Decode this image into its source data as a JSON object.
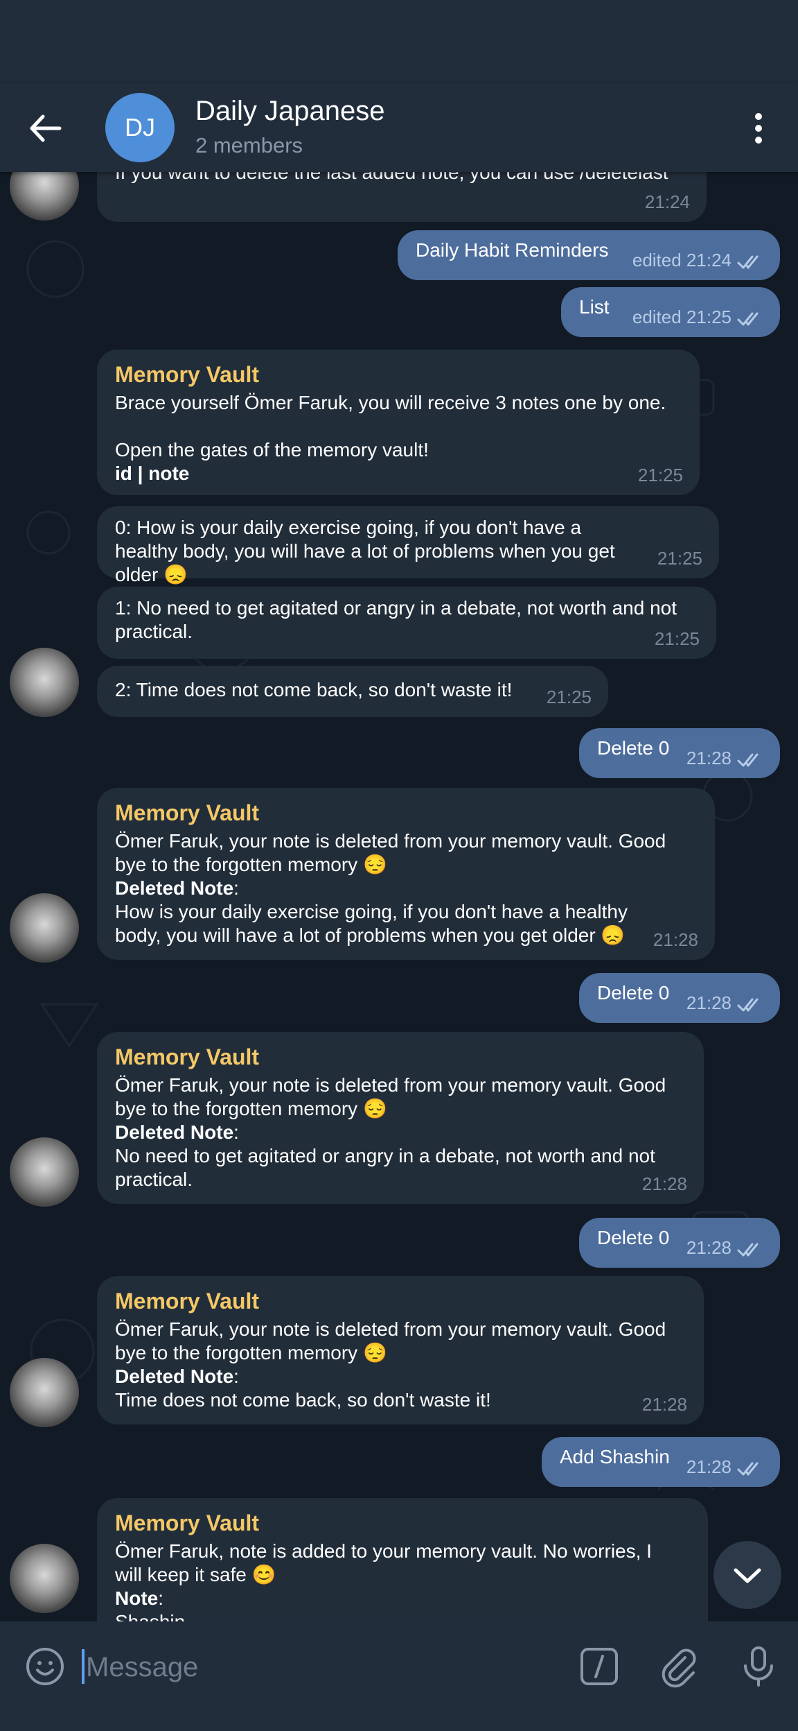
{
  "header": {
    "avatar_initials": "DJ",
    "title": "Daily Japanese",
    "subtitle": "2 members"
  },
  "messages": {
    "m0": {
      "text": "If you want to delete the last added note, you can use /deletelast",
      "time": "21:24"
    },
    "m1": {
      "text": "Daily Habit Reminders",
      "time": "edited 21:24"
    },
    "m2": {
      "text": "List",
      "time": "edited 21:25"
    },
    "m3": {
      "sender": "Memory Vault",
      "line1": "Brace yourself Ömer Faruk, you will receive 3 notes one by one.",
      "line2": "Open the gates of the memory vault!",
      "line3": "id | note",
      "time": "21:25"
    },
    "m4": {
      "text": "0: How is your daily exercise going, if you don't have a healthy body, you will have a lot of problems when you get older 😞",
      "time": "21:25"
    },
    "m5": {
      "text": "1: No need to get agitated or angry in a debate, not worth and not practical.",
      "time": "21:25"
    },
    "m6": {
      "text": "2: Time does not come back, so don't waste it!",
      "time": "21:25"
    },
    "m7": {
      "text": "Delete 0",
      "time": "21:28"
    },
    "m8": {
      "sender": "Memory Vault",
      "intro": "Ömer Faruk, your note is deleted from your memory vault. Good bye to the forgotten memory 😔",
      "label": "Deleted Note",
      "colon": ":",
      "note": "How is your daily exercise going, if you don't have a healthy body, you will have a lot of problems when you get older 😞",
      "time": "21:28"
    },
    "m9": {
      "text": "Delete 0",
      "time": "21:28"
    },
    "m10": {
      "sender": "Memory Vault",
      "intro": "Ömer Faruk, your note is deleted from your memory vault. Good bye to the forgotten memory 😔",
      "label": "Deleted Note",
      "colon": ":",
      "note": "No need to get agitated or angry in a debate, not worth and not practical.",
      "time": "21:28"
    },
    "m11": {
      "text": "Delete 0",
      "time": "21:28"
    },
    "m12": {
      "sender": "Memory Vault",
      "intro": "Ömer Faruk, your note is deleted from your memory vault. Good bye to the forgotten memory 😔",
      "label": "Deleted Note",
      "colon": ":",
      "note": "Time does not come back, so don't waste it!",
      "time": "21:28"
    },
    "m13": {
      "text": "Add Shashin",
      "time": "21:28"
    },
    "m14": {
      "sender": "Memory Vault",
      "intro": "Ömer Faruk, note is added to your memory vault. No worries, I will keep it safe 😊",
      "label": "Note",
      "colon": ":",
      "note": "Shashin"
    }
  },
  "input": {
    "placeholder": "Message"
  },
  "icons": {
    "back": "arrow-left-icon",
    "menu": "more-vertical-icon",
    "emoji": "emoji-icon",
    "commands": "slash-command-icon",
    "attach": "paperclip-icon",
    "mic": "microphone-icon",
    "scroll": "chevron-down-icon",
    "read": "double-check-icon"
  },
  "colors": {
    "header_bg": "#212d3b",
    "chat_bg": "#111a25",
    "incoming_bubble": "#222d3a",
    "outgoing_bubble": "#4d6d9c",
    "sender_name": "#f4c867",
    "avatar_dj": "#4f8ed8",
    "accent": "#5ea0f0"
  }
}
